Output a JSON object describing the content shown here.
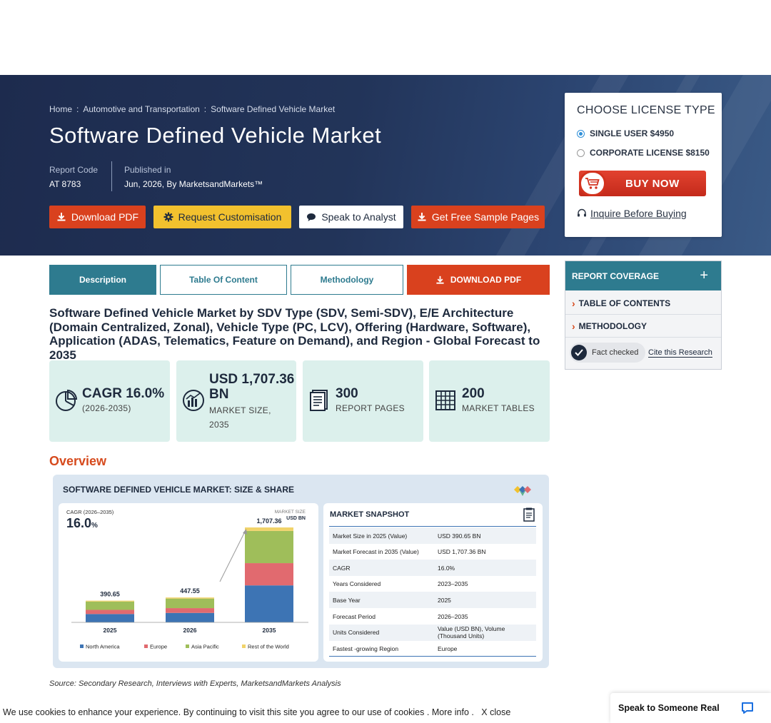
{
  "breadcrumb": {
    "items": [
      "Home",
      "Automotive and Transportation",
      "Software Defined Vehicle Market"
    ],
    "separator": ":"
  },
  "page_title": "Software Defined Vehicle Market",
  "meta": {
    "report_code_label": "Report Code",
    "report_code": "AT 8783",
    "published_label": "Published in",
    "published": "Jun, 2026, By MarketsandMarkets™"
  },
  "hero_buttons": {
    "download_pdf": "Download PDF",
    "request_customisation": "Request Customisation",
    "speak_to_analyst": "Speak to Analyst",
    "free_sample": "Get Free Sample Pages"
  },
  "license": {
    "title": "CHOOSE LICENSE TYPE",
    "options": [
      {
        "label": "SINGLE USER $4950",
        "selected": true
      },
      {
        "label": "CORPORATE LICENSE $8150",
        "selected": false
      }
    ],
    "buy_now": "BUY NOW",
    "inquire": "Inquire Before Buying"
  },
  "tabs": [
    {
      "label": "Description",
      "active": true
    },
    {
      "label": "Table Of Content",
      "active": false
    },
    {
      "label": "Methodology",
      "active": false
    },
    {
      "label": "DOWNLOAD PDF",
      "active": false
    }
  ],
  "report_title": "Software Defined Vehicle Market by SDV Type (SDV, Semi-SDV), E/E Architecture (Domain Centralized, Zonal), Vehicle Type (PC, LCV), Offering (Hardware, Software), Application (ADAS, Telematics, Feature on Demand), and Region - Global Forecast to 2035",
  "stats": [
    {
      "icon": "pie-chart-icon",
      "value": "CAGR 16.0%",
      "label": "(2026-2035)"
    },
    {
      "icon": "globe-chart-icon",
      "value": "USD 1,707.36 BN",
      "label": "MARKET SIZE, 2035"
    },
    {
      "icon": "document-icon",
      "value": "300",
      "label": "REPORT PAGES"
    },
    {
      "icon": "table-icon",
      "value": "200",
      "label": "MARKET TABLES"
    }
  ],
  "overview_heading": "Overview",
  "infographic": {
    "title": "SOFTWARE DEFINED VEHICLE MARKET: SIZE & SHARE",
    "cagr_label": "CAGR (2026–2035)",
    "cagr_value": "16.0",
    "cagr_unit": "%",
    "market_size_label": "MARKET SIZE",
    "market_size_unit": "USD BN",
    "snapshot_title": "MARKET SNAPSHOT",
    "snapshot_rows": [
      {
        "k": "Market Size in 2025 (Value)",
        "v": "USD 390.65 BN"
      },
      {
        "k": "Market Forecast in 2035 (Value)",
        "v": "USD 1,707.36 BN"
      },
      {
        "k": "CAGR",
        "v": "16.0%"
      },
      {
        "k": "Years Considered",
        "v": "2023–2035"
      },
      {
        "k": "Base Year",
        "v": "2025"
      },
      {
        "k": "Forecast Period",
        "v": "2026–2035"
      },
      {
        "k": "Units Considered",
        "v": "Value (USD BN), Volume (Thousand Units)"
      },
      {
        "k": "Fastest -growing Region",
        "v": "Europe"
      }
    ]
  },
  "chart_data": {
    "type": "bar",
    "stacked": true,
    "categories": [
      "2025",
      "2026",
      "2035"
    ],
    "totals": [
      390.65,
      447.55,
      1707.36
    ],
    "series": [
      {
        "name": "North America",
        "color": "#3d74b4",
        "values": [
          150,
          170,
          665
        ]
      },
      {
        "name": "Europe",
        "color": "#e16a6f",
        "values": [
          75,
          86,
          400
        ]
      },
      {
        "name": "Asia Pacific",
        "color": "#9fbe5a",
        "values": [
          150,
          172,
          580
        ]
      },
      {
        "name": "Rest of the World",
        "color": "#f1d36a",
        "values": [
          15.65,
          19.55,
          62.36
        ]
      }
    ],
    "total_labels": [
      "390.65",
      "447.55",
      "1,707.36"
    ]
  },
  "source": "Source: Secondary Research, Interviews with Experts, MarketsandMarkets Analysis",
  "sidebar": {
    "header": "REPORT COVERAGE",
    "plus": "+",
    "items": [
      "TABLE OF CONTENTS",
      "METHODOLOGY"
    ],
    "fact_checked": "Fact checked",
    "cite": "Cite this Research"
  },
  "cookie": {
    "text": "We use cookies to enhance your experience. By continuing to visit this site you agree to our use of cookies .",
    "more_info": "More info .",
    "close": "X close"
  },
  "chat": {
    "label": "Speak to Someone Real"
  },
  "colors": {
    "accent_orange": "#d64a1d",
    "teal": "#2e7b8f",
    "yellow": "#f2c12e",
    "hero_bg": "#1d2b4e"
  }
}
